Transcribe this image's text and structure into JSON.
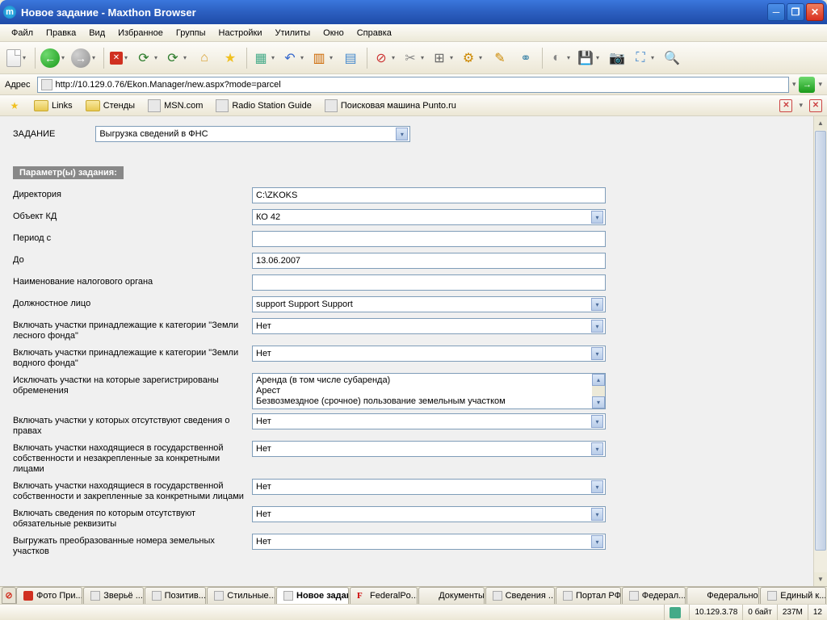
{
  "window": {
    "title": "Новое задание - Maxthon Browser"
  },
  "menu": {
    "items": [
      "Файл",
      "Правка",
      "Вид",
      "Избранное",
      "Группы",
      "Настройки",
      "Утилиты",
      "Окно",
      "Справка"
    ]
  },
  "address": {
    "label": "Адрес",
    "url": "http://10.129.0.76/Ekon.Manager/new.aspx?mode=parcel"
  },
  "bookmarks": {
    "items": [
      "Links",
      "Стенды",
      "MSN.com",
      "Radio Station Guide",
      "Поисковая машина Punto.ru"
    ]
  },
  "form": {
    "task_label": "ЗАДАНИЕ",
    "task_value": "Выгрузка сведений в ФНС",
    "params_header": "Параметр(ы) задания:",
    "rows": [
      {
        "label": "Директория",
        "type": "text",
        "value": "C:\\ZKOKS"
      },
      {
        "label": "Объект КД",
        "type": "select",
        "value": "КО 42"
      },
      {
        "label": "Период с",
        "type": "text",
        "value": ""
      },
      {
        "label": "До",
        "type": "text",
        "value": "13.06.2007"
      },
      {
        "label": "Наименование налогового органа",
        "type": "text",
        "value": ""
      },
      {
        "label": "Должностное лицо",
        "type": "select",
        "value": "support Support Support"
      },
      {
        "label": "Включать участки принадлежащие к категории \"Земли лесного фонда\"",
        "type": "select",
        "value": "Нет"
      },
      {
        "label": "Включать участки принадлежащие к категории \"Земли водного фонда\"",
        "type": "select",
        "value": "Нет"
      },
      {
        "label": "Исключать участки на которые зарегистрированы обременения",
        "type": "list",
        "items": [
          "Аренда (в том числе субаренда)",
          "Арест",
          "Безвозмездное (срочное) пользование земельным участком"
        ]
      },
      {
        "label": "Включать участки у которых отсутствуют сведения о правах",
        "type": "select",
        "value": "Нет"
      },
      {
        "label": "Включать участки находящиеся в государственной собственности и незакрепленные за конкретными лицами",
        "type": "select",
        "value": "Нет"
      },
      {
        "label": "Включать участки находящиеся в государственной собственности и закрепленные за конкретными лицами",
        "type": "select",
        "value": "Нет"
      },
      {
        "label": "Включать сведения по которым отсутствуют обязательные реквизиты",
        "type": "select",
        "value": "Нет"
      },
      {
        "label": "Выгружать преобразованные номера земельных участков",
        "type": "select",
        "value": "Нет"
      }
    ]
  },
  "tabs": {
    "items": [
      {
        "label": "Фото При...",
        "icon": "stop"
      },
      {
        "label": "Зверьё ...",
        "icon": "page"
      },
      {
        "label": "Позитив...",
        "icon": "page"
      },
      {
        "label": "Стильные...",
        "icon": "page"
      },
      {
        "label": "Новое задание",
        "icon": "page",
        "active": true
      },
      {
        "label": "FederalPo...",
        "icon": "f"
      },
      {
        "label": "Документы",
        "icon": "none"
      },
      {
        "label": "Сведения ...",
        "icon": "page"
      },
      {
        "label": "Портал РФ",
        "icon": "page"
      },
      {
        "label": "Федерал...",
        "icon": "page"
      },
      {
        "label": "Федерально...",
        "icon": "none"
      },
      {
        "label": "Единый к...",
        "icon": "page"
      }
    ]
  },
  "status": {
    "ip": "10.129.3.78",
    "bytes": "0 байт",
    "mem": "237M",
    "count": "12"
  }
}
